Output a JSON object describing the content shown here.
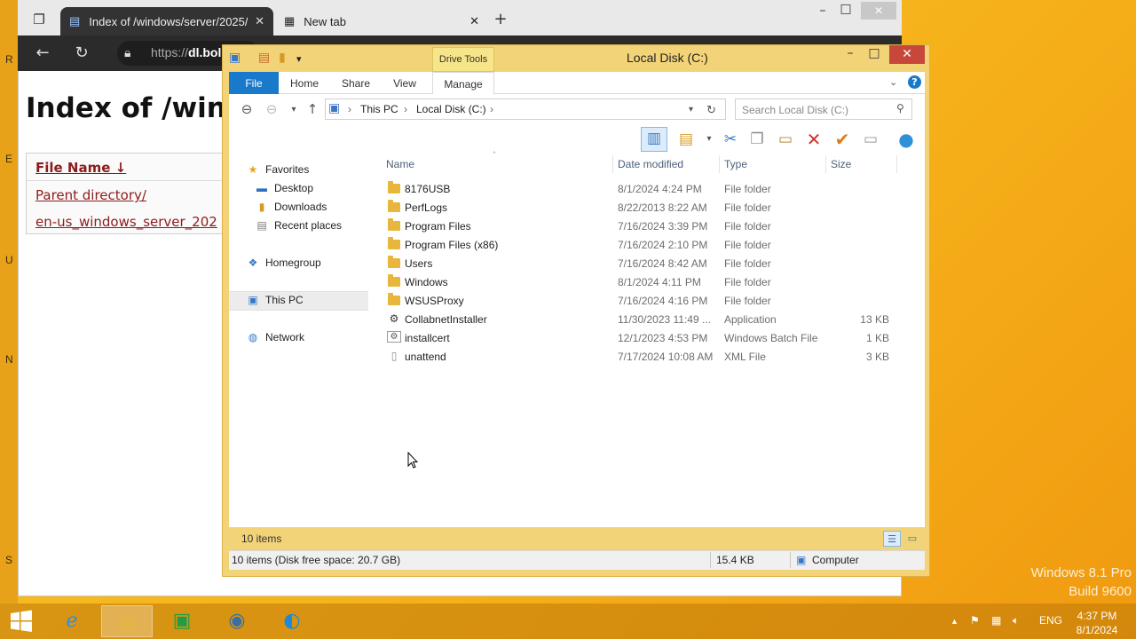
{
  "desktop": {
    "watermark_line1": "Windows 8.1 Pro",
    "watermark_line2": "Build 9600",
    "edge_letters": [
      "R",
      "E",
      "U",
      "N",
      "S"
    ]
  },
  "browser": {
    "tabs": [
      {
        "label": "Index of /windows/server/2025/",
        "icon": "page-icon"
      },
      {
        "label": "New tab",
        "icon": "newtab-icon"
      }
    ],
    "url_prefix": "https://",
    "url_host": "dl.bol",
    "page_title": "Index of /windo",
    "table_header": "File Name  ↓",
    "links": [
      "Parent directory/",
      "en-us_windows_server_202"
    ]
  },
  "explorer": {
    "title": "Local Disk (C:)",
    "context_tab": "Drive Tools",
    "ribbon_tabs": [
      "File",
      "Home",
      "Share",
      "View",
      "Manage"
    ],
    "breadcrumb": [
      "This PC",
      "Local Disk (C:)"
    ],
    "search_placeholder": "Search Local Disk (C:)",
    "nav": {
      "favorites": "Favorites",
      "favorites_items": [
        "Desktop",
        "Downloads",
        "Recent places"
      ],
      "homegroup": "Homegroup",
      "this_pc": "This PC",
      "network": "Network"
    },
    "columns": {
      "name": "Name",
      "date": "Date modified",
      "type": "Type",
      "size": "Size"
    },
    "files": [
      {
        "name": "8176USB",
        "date": "8/1/2024 4:24 PM",
        "type": "File folder",
        "size": "",
        "kind": "folder"
      },
      {
        "name": "PerfLogs",
        "date": "8/22/2013 8:22 AM",
        "type": "File folder",
        "size": "",
        "kind": "folder"
      },
      {
        "name": "Program Files",
        "date": "7/16/2024 3:39 PM",
        "type": "File folder",
        "size": "",
        "kind": "folder"
      },
      {
        "name": "Program Files (x86)",
        "date": "7/16/2024 2:10 PM",
        "type": "File folder",
        "size": "",
        "kind": "folder"
      },
      {
        "name": "Users",
        "date": "7/16/2024 8:42 AM",
        "type": "File folder",
        "size": "",
        "kind": "folder"
      },
      {
        "name": "Windows",
        "date": "8/1/2024 4:11 PM",
        "type": "File folder",
        "size": "",
        "kind": "folder"
      },
      {
        "name": "WSUSProxy",
        "date": "7/16/2024 4:16 PM",
        "type": "File folder",
        "size": "",
        "kind": "folder"
      },
      {
        "name": "CollabnetInstaller",
        "date": "11/30/2023 11:49 ...",
        "type": "Application",
        "size": "13 KB",
        "kind": "app"
      },
      {
        "name": "installcert",
        "date": "12/1/2023 4:53 PM",
        "type": "Windows Batch File",
        "size": "1 KB",
        "kind": "batch"
      },
      {
        "name": "unattend",
        "date": "7/17/2024 10:08 AM",
        "type": "XML File",
        "size": "3 KB",
        "kind": "xml"
      }
    ],
    "items_count": "10 items",
    "status_left": "10 items (Disk free space: 20.7 GB)",
    "status_size": "15.4 KB",
    "status_computer": "Computer"
  },
  "taskbar": {
    "lang": "ENG",
    "time": "4:37 PM",
    "date": "8/1/2024"
  }
}
